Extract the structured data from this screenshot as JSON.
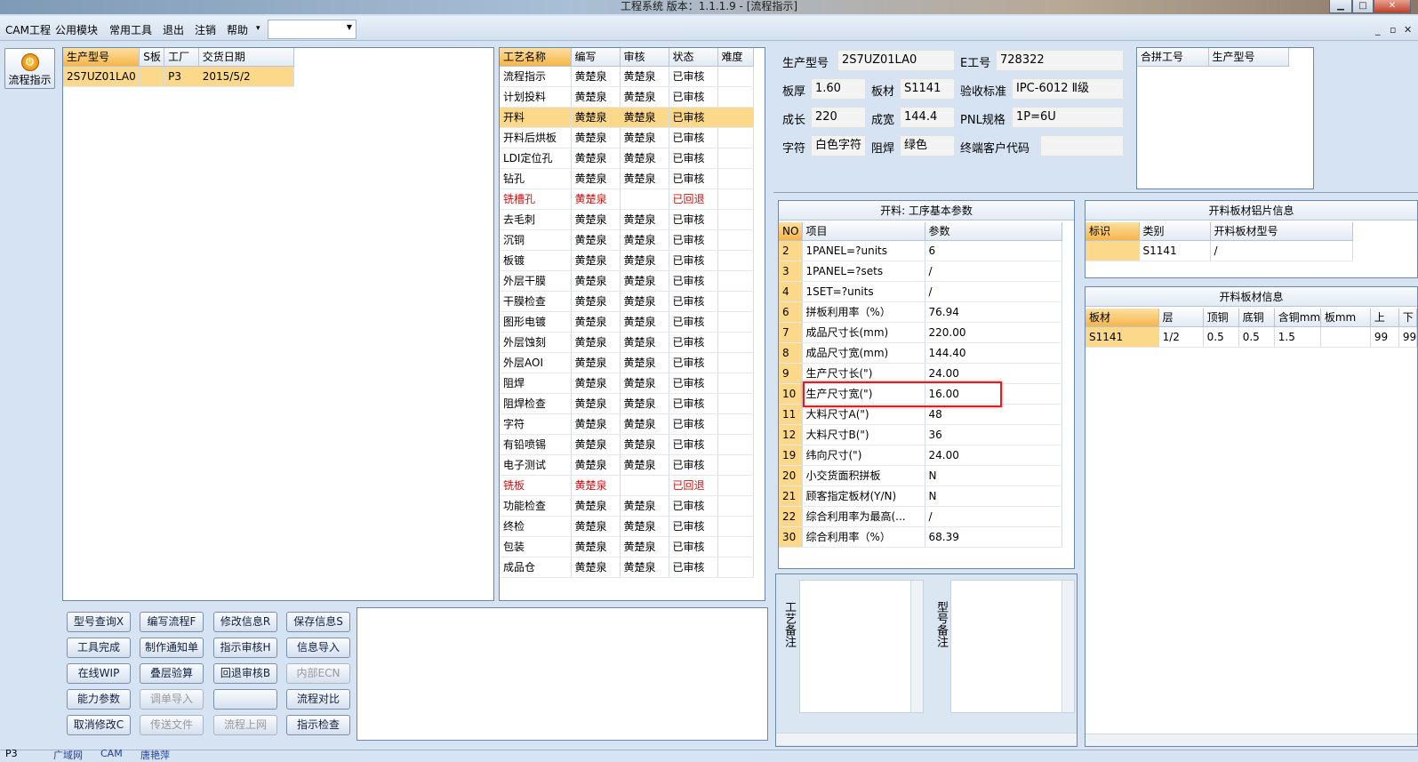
{
  "window": {
    "title": "工程系统   版本：1.1.1.9 - [流程指示]",
    "min": "▁",
    "max": "□",
    "close": "✕"
  },
  "menu": {
    "items": [
      "CAM工程",
      "公用模块",
      "常用工具",
      "退出",
      "注销",
      "帮助"
    ],
    "help_arrow": "▾",
    "combo_value": "",
    "mdi": [
      "_",
      "▫",
      "✕"
    ]
  },
  "left": {
    "flow_button": "流程指示"
  },
  "model_table": {
    "headers": [
      "生产型号",
      "S板",
      "工厂",
      "交货日期"
    ],
    "rows": [
      [
        "2S7UZ01LA0",
        "",
        "P3",
        "2015/5/2"
      ]
    ]
  },
  "process_table": {
    "headers": [
      "工艺名称",
      "编写",
      "审核",
      "状态",
      "难度"
    ],
    "rows": [
      [
        "流程指示",
        "黄楚泉",
        "黄楚泉",
        "已审核",
        ""
      ],
      [
        "计划投料",
        "黄楚泉",
        "黄楚泉",
        "已审核",
        ""
      ],
      [
        "开料",
        "黄楚泉",
        "黄楚泉",
        "已审核",
        ""
      ],
      [
        "开料后烘板",
        "黄楚泉",
        "黄楚泉",
        "已审核",
        ""
      ],
      [
        "LDI定位孔",
        "黄楚泉",
        "黄楚泉",
        "已审核",
        ""
      ],
      [
        "钻孔",
        "黄楚泉",
        "黄楚泉",
        "已审核",
        ""
      ],
      [
        "铣槽孔",
        "黄楚泉",
        "",
        "已回退",
        ""
      ],
      [
        "去毛刺",
        "黄楚泉",
        "黄楚泉",
        "已审核",
        ""
      ],
      [
        "沉铜",
        "黄楚泉",
        "黄楚泉",
        "已审核",
        ""
      ],
      [
        "板镀",
        "黄楚泉",
        "黄楚泉",
        "已审核",
        ""
      ],
      [
        "外层干膜",
        "黄楚泉",
        "黄楚泉",
        "已审核",
        ""
      ],
      [
        "干膜检查",
        "黄楚泉",
        "黄楚泉",
        "已审核",
        ""
      ],
      [
        "图形电镀",
        "黄楚泉",
        "黄楚泉",
        "已审核",
        ""
      ],
      [
        "外层蚀刻",
        "黄楚泉",
        "黄楚泉",
        "已审核",
        ""
      ],
      [
        "外层AOI",
        "黄楚泉",
        "黄楚泉",
        "已审核",
        ""
      ],
      [
        "阻焊",
        "黄楚泉",
        "黄楚泉",
        "已审核",
        ""
      ],
      [
        "阻焊检查",
        "黄楚泉",
        "黄楚泉",
        "已审核",
        ""
      ],
      [
        "字符",
        "黄楚泉",
        "黄楚泉",
        "已审核",
        ""
      ],
      [
        "有铅喷锡",
        "黄楚泉",
        "黄楚泉",
        "已审核",
        ""
      ],
      [
        "电子测试",
        "黄楚泉",
        "黄楚泉",
        "已审核",
        ""
      ],
      [
        "铣板",
        "黄楚泉",
        "",
        "已回退",
        ""
      ],
      [
        "功能检查",
        "黄楚泉",
        "黄楚泉",
        "已审核",
        ""
      ],
      [
        "终检",
        "黄楚泉",
        "黄楚泉",
        "已审核",
        ""
      ],
      [
        "包装",
        "黄楚泉",
        "黄楚泉",
        "已审核",
        ""
      ],
      [
        "成品仓",
        "黄楚泉",
        "黄楚泉",
        "已审核",
        ""
      ]
    ],
    "selected_index": 2,
    "returned_rows": [
      6,
      20
    ]
  },
  "info": {
    "model_label": "生产型号",
    "model": "2S7UZ01LA0",
    "e_label": "E工号",
    "e": "728322",
    "thick_label": "板厚",
    "thick": "1.60",
    "mat_label": "板材",
    "mat": "S1141",
    "std_label": "验收标准",
    "std": "IPC-6012 Ⅱ级",
    "len_label": "成长",
    "len": "220",
    "wid_label": "成宽",
    "wid": "144.4",
    "pnl_label": "PNL规格",
    "pnl": "1P=6U",
    "char_label": "字符",
    "char": "白色字符",
    "mask_label": "阻焊",
    "mask": "绿色",
    "cust_label": "终端客户代码",
    "cust": ""
  },
  "merge_table": {
    "headers": [
      "合拼工号",
      "生产型号"
    ]
  },
  "params": {
    "title": "开料: 工序基本参数",
    "headers": [
      "NO",
      "项目",
      "参数"
    ],
    "rows": [
      [
        "2",
        "1PANEL=?units",
        "6"
      ],
      [
        "3",
        "1PANEL=?sets",
        "/"
      ],
      [
        "4",
        "1SET=?units",
        "/"
      ],
      [
        "6",
        "拼板利用率（%）",
        "76.94"
      ],
      [
        "7",
        "成品尺寸长(mm)",
        "220.00"
      ],
      [
        "8",
        "成品尺寸宽(mm)",
        "144.40"
      ],
      [
        "9",
        "生产尺寸长(\")",
        "24.00"
      ],
      [
        "10",
        "生产尺寸宽(\")",
        "16.00"
      ],
      [
        "11",
        "大料尺寸A(\")",
        "48"
      ],
      [
        "12",
        "大料尺寸B(\")",
        "36"
      ],
      [
        "19",
        "纬向尺寸(\")",
        "24.00"
      ],
      [
        "20",
        "小交货面积拼板",
        "N"
      ],
      [
        "21",
        "顾客指定板材(Y/N)",
        "N"
      ],
      [
        "22",
        "综合利用率为最高(...",
        "/"
      ],
      [
        "30",
        "综合利用率（%）",
        "68.39"
      ]
    ]
  },
  "alu_sheet": {
    "title": "开料板材铝片信息",
    "headers": [
      "标识",
      "类别",
      "开料板材型号"
    ],
    "rows": [
      [
        "",
        "S1141",
        "/"
      ]
    ]
  },
  "sheet_info": {
    "title": "开料板材信息",
    "headers": [
      "板材",
      "层",
      "顶铜",
      "底铜",
      "含铜mm",
      "板mm",
      "上",
      "下"
    ],
    "rows": [
      [
        "S1141",
        "1/2",
        "0.5",
        "0.5",
        "1.5",
        "",
        "99",
        "99"
      ]
    ]
  },
  "notes": {
    "process_label": "工艺备注",
    "model_label": "型号备注"
  },
  "buttons": [
    [
      "型号查询X",
      "编写流程F",
      "修改信息R",
      "保存信息S"
    ],
    [
      "工具完成",
      "制作通知单",
      "指示审核H",
      "信息导入"
    ],
    [
      "在线WIP",
      "叠层验算",
      "回退审核B",
      "内部ECN"
    ],
    [
      "能力参数",
      "调单导入",
      "",
      "流程对比"
    ],
    [
      "取消修改C",
      "传送文件",
      "流程上网",
      "指示检查"
    ]
  ],
  "disabled_buttons": [
    "内部ECN",
    "调单导入",
    "传送文件",
    "流程上网"
  ],
  "statusbar": {
    "items": [
      "P3",
      "广域网",
      "CAM",
      "唐艳萍"
    ]
  }
}
